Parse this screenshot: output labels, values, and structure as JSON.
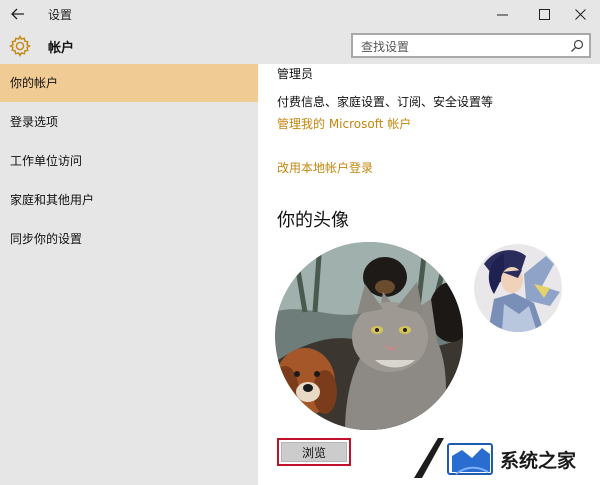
{
  "window": {
    "title": "设置"
  },
  "header": {
    "title": "帐户"
  },
  "search": {
    "placeholder": "查找设置"
  },
  "sidebar": {
    "items": [
      {
        "label": "你的帐户",
        "active": true
      },
      {
        "label": "登录选项",
        "active": false
      },
      {
        "label": "工作单位访问",
        "active": false
      },
      {
        "label": "家庭和其他用户",
        "active": false
      },
      {
        "label": "同步你的设置",
        "active": false
      }
    ]
  },
  "account": {
    "role": "管理员",
    "details": "付费信息、家庭设置、订阅、安全设置等",
    "manage_link": "管理我的 Microsoft 帐户",
    "local_link": "改用本地帐户登录"
  },
  "avatar": {
    "heading": "你的头像",
    "browse_label": "浏览"
  },
  "watermark": {
    "text": "系统之家"
  },
  "colors": {
    "accent": "#c4870f",
    "active_nav": "#f1cb94",
    "panel": "#e6e6e6",
    "highlight_border": "#c0102a"
  }
}
